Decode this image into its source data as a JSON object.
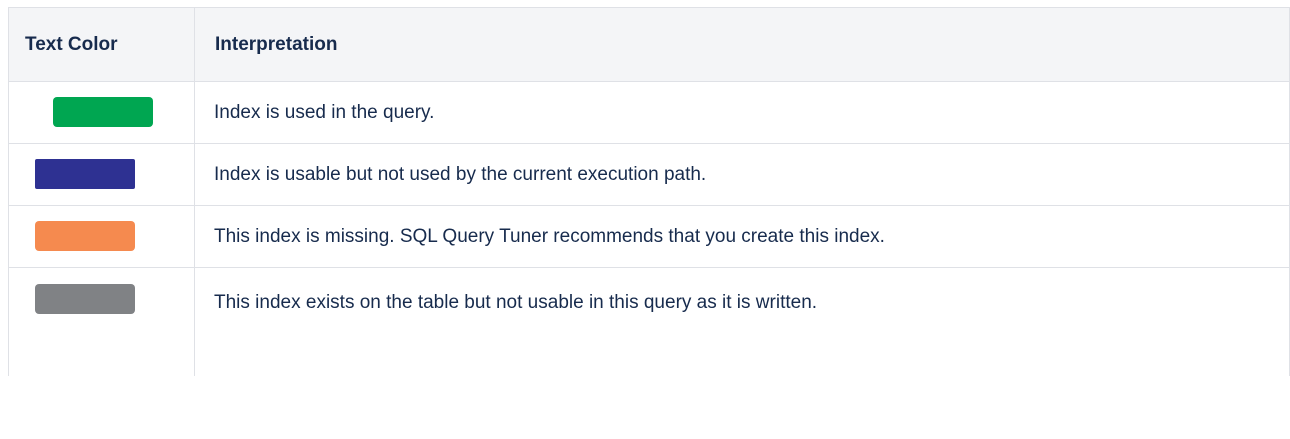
{
  "table": {
    "headers": {
      "text_color": "Text Color",
      "interpretation": "Interpretation"
    },
    "rows": [
      {
        "color_name": "green",
        "color": "#00a651",
        "interpretation": "Index is used in the query."
      },
      {
        "color_name": "blue",
        "color": "#2e3192",
        "interpretation": "Index is usable but not used by the current execution path."
      },
      {
        "color_name": "orange",
        "color": "#f58a4f",
        "interpretation": "This index is missing. SQL Query Tuner recommends that you create this index."
      },
      {
        "color_name": "gray",
        "color": "#808285",
        "interpretation": "This index exists on the table but not usable in this query as it is written."
      }
    ]
  }
}
